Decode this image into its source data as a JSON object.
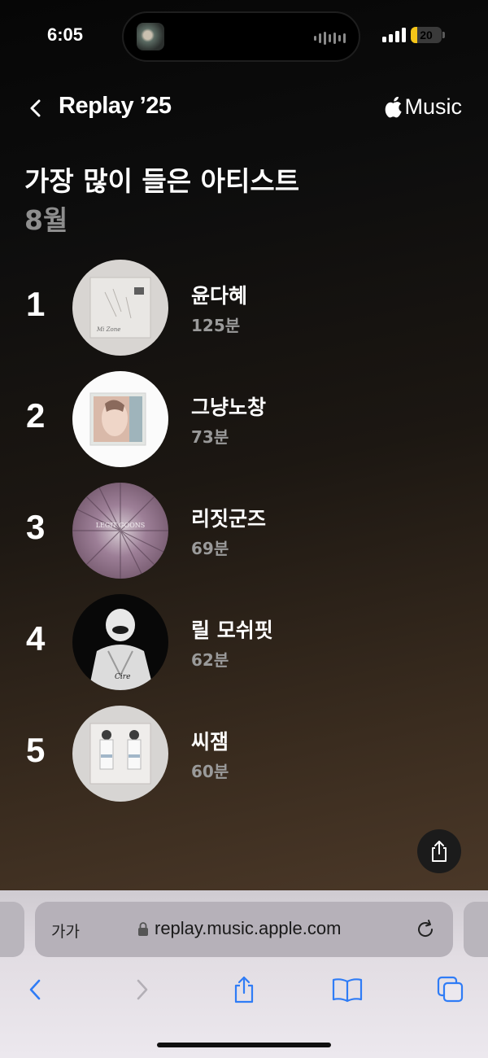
{
  "status_bar": {
    "time": "6:05",
    "battery_text": "20",
    "battery_level": 0.2
  },
  "header": {
    "title": "Replay ’25",
    "brand": "Music",
    "icons": {
      "back": "chevron-left-icon",
      "brand_logo": "apple-logo-icon"
    }
  },
  "page": {
    "title": "가장 많이 들은 아티스트",
    "subtitle": "8월"
  },
  "artists": [
    {
      "rank": "1",
      "name": "윤다혜",
      "minutes": "125분",
      "art_caption": "Mi Zone"
    },
    {
      "rank": "2",
      "name": "그냥노창",
      "minutes": "73분"
    },
    {
      "rank": "3",
      "name": "리짓군즈",
      "minutes": "69분",
      "art_caption": "LEGIT GOONS"
    },
    {
      "rank": "4",
      "name": "릴 모쉬핏",
      "minutes": "62분",
      "art_caption": "Cire"
    },
    {
      "rank": "5",
      "name": "씨잼",
      "minutes": "60분"
    }
  ],
  "share_button": {
    "icon": "share-icon"
  },
  "browser": {
    "text_size_label": "가가",
    "url": "replay.music.apple.com",
    "icons": {
      "lock": "lock-icon",
      "reload": "reload-icon",
      "back": "back-icon",
      "forward": "forward-icon",
      "share": "share-icon",
      "bookmarks": "book-icon",
      "tabs": "tabs-icon"
    }
  },
  "colors": {
    "accent_blue": "#2f7cf6",
    "battery_yellow": "#f5c518",
    "secondary_text": "#9a9a9a"
  }
}
